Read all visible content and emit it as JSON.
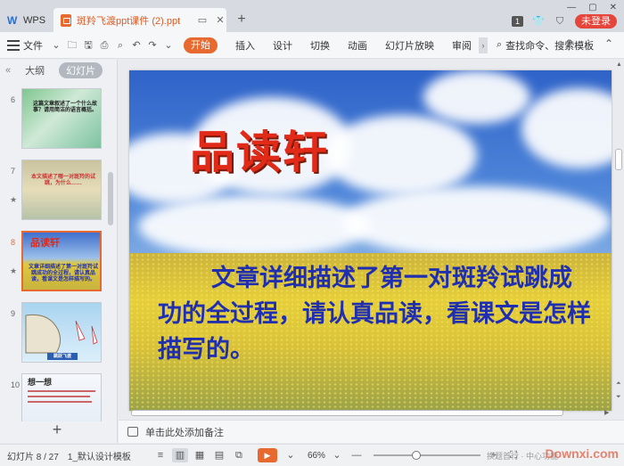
{
  "titlebar": {
    "app_tab": "WPS",
    "doc_tab": "斑羚飞渡ppt课件 (2).ppt",
    "new_tab": "+",
    "page_badge": "1",
    "login": "未登录"
  },
  "ribbon": {
    "file": "文件",
    "tabs": [
      "开始",
      "插入",
      "设计",
      "切换",
      "动画",
      "幻灯片放映",
      "审阅"
    ],
    "search": "查找命令、搜索模板",
    "help": "?"
  },
  "left_panel": {
    "tabs": [
      "大纲",
      "幻灯片"
    ],
    "active_tab": "幻灯片",
    "thumbnails": [
      {
        "num": "6",
        "text": "这篇文章叙述了一个什么故事？请用简洁的语言概括。"
      },
      {
        "num": "7",
        "text": "本文描述了哪一对斑羚的试跳，为什么……"
      },
      {
        "num": "8",
        "title": "品读轩",
        "text": "文章详细描述了第一对斑羚试跳成功的全过程，请认真品读，看课文是怎样描写的。",
        "selected": true
      },
      {
        "num": "9",
        "caption": "跳跃飞渡"
      },
      {
        "num": "10",
        "title": "想一想"
      }
    ],
    "add": "+"
  },
  "slide": {
    "title": "品读轩",
    "body": "文章详细描述了第一对斑羚试跳成功的全过程，请认真品读，看课文是怎样描写的。"
  },
  "notes": {
    "placeholder": "单击此处添加备注"
  },
  "statusbar": {
    "slide_count": "幻灯片 8 / 27",
    "theme": "1_默认设计模板",
    "zoom": "66%",
    "zoom_fraction": 0.66,
    "watermark": "Downxi.com",
    "watermark_sub": "换题首行 · 中心功能"
  }
}
